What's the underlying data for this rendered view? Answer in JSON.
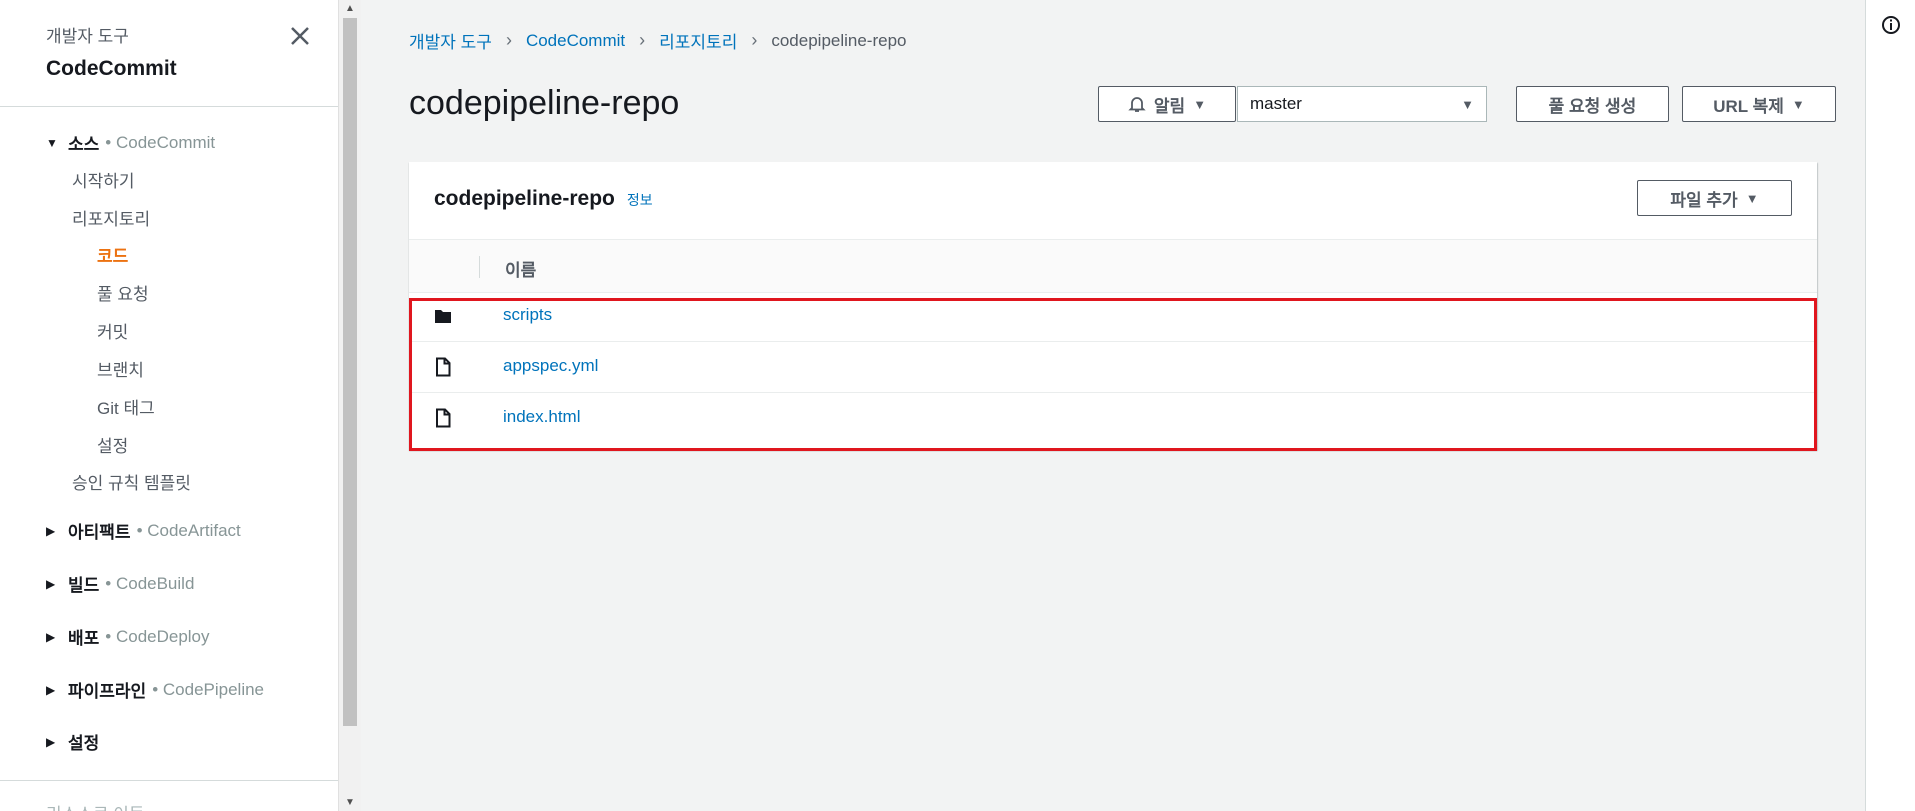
{
  "sidebar": {
    "subtitle": "개발자 도구",
    "title": "CodeCommit",
    "sections": [
      {
        "label": "소스",
        "service": "• CodeCommit"
      },
      {
        "label": "아티팩트",
        "service": "• CodeArtifact"
      },
      {
        "label": "빌드",
        "service": "• CodeBuild"
      },
      {
        "label": "배포",
        "service": "• CodeDeploy"
      },
      {
        "label": "파이프라인",
        "service": "• CodePipeline"
      },
      {
        "label": "설정",
        "service": ""
      }
    ],
    "items": {
      "getting_started": "시작하기",
      "repositories": "리포지토리",
      "code": "코드",
      "pull_requests": "풀 요청",
      "commits": "커밋",
      "branches": "브랜치",
      "git_tags": "Git 태그",
      "settings": "설정",
      "approval_templates": "승인 규칙 템플릿"
    },
    "bottom_faded": "리소스로 이동"
  },
  "breadcrumb": [
    "개발자 도구",
    "CodeCommit",
    "리포지토리",
    "codepipeline-repo"
  ],
  "header": {
    "title": "codepipeline-repo",
    "notify_label": "알림",
    "branch_value": "master",
    "create_pr_label": "풀 요청 생성",
    "copy_url_label": "URL 복제"
  },
  "panel": {
    "title": "codepipeline-repo",
    "info_label": "정보",
    "add_file_label": "파일 추가",
    "column_name": "이름",
    "files": [
      {
        "name": "scripts",
        "type": "folder"
      },
      {
        "name": "appspec.yml",
        "type": "file"
      },
      {
        "name": "index.html",
        "type": "file"
      }
    ]
  },
  "colors": {
    "accent": "#ec7211",
    "link": "#0073bb",
    "highlight": "#e0161e"
  }
}
